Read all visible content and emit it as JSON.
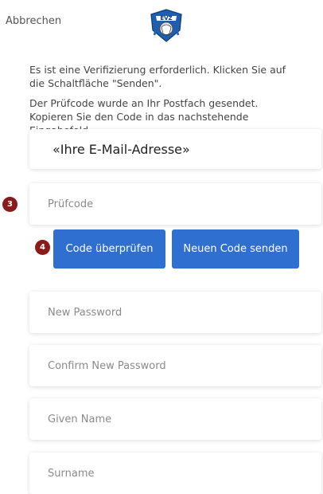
{
  "header": {
    "cancel_label": "Abbrechen",
    "logo_text": "EVZ"
  },
  "messages": {
    "verification_required": "Es ist eine Verifizierung erforderlich. Klicken Sie auf die Schaltfläche \"Senden\".",
    "code_sent": "Der Prüfcode wurde an Ihr Postfach gesendet. Kopieren Sie den Code in das nachstehende Eingabefeld."
  },
  "form": {
    "email_value": "«Ihre E-Mail-Adresse»",
    "verification_code_placeholder": "Prüfcode",
    "verify_button_label": "Code überprüfen",
    "resend_button_label": "Neuen Code senden",
    "new_password_placeholder": "New Password",
    "confirm_password_placeholder": "Confirm New Password",
    "given_name_placeholder": "Given Name",
    "surname_placeholder": "Surname"
  },
  "badges": {
    "step_3": "3",
    "step_4": "4"
  },
  "colors": {
    "primary_button": "#2f6fd0",
    "badge": "#8b1a1a",
    "logo_blue": "#1f5fae"
  }
}
